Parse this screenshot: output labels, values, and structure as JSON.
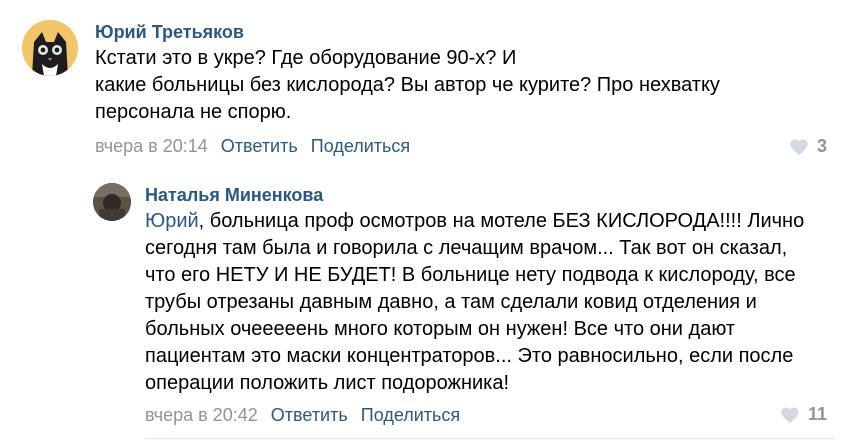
{
  "comments": [
    {
      "author": "Юрий Третьяков",
      "text_lines": [
        "Кстати это в укре?  Где оборудование 90-х?  И",
        "какие больницы без кислорода?  Вы автор че курите?  Про нехватку",
        "персонала не спорю."
      ],
      "time": "вчера в 20:14",
      "reply_label": "Ответить",
      "share_label": "Поделиться",
      "likes": "3"
    },
    {
      "author": "Наталья Миненкова",
      "reply_to": "Юрий",
      "text_lines": [
        ", больница проф осмотров на мотеле БЕЗ КИСЛОРОДА!!!! Лично",
        "сегодня там была и говорила с лечащим врачом... Так вот он сказал,",
        "что его НЕТУ И НЕ БУДЕТ! В больнице нету подвода к кислороду, все",
        "трубы отрезаны давным давно, а там сделали ковид отделения и",
        "больных очееееень много которым он нужен! Все что они дают",
        "пациентам это маски концентраторов... Это равносильно, если после",
        "операции положить лист подорожника!"
      ],
      "time": "вчера в 20:42",
      "reply_label": "Ответить",
      "share_label": "Поделиться",
      "likes": "11"
    }
  ]
}
